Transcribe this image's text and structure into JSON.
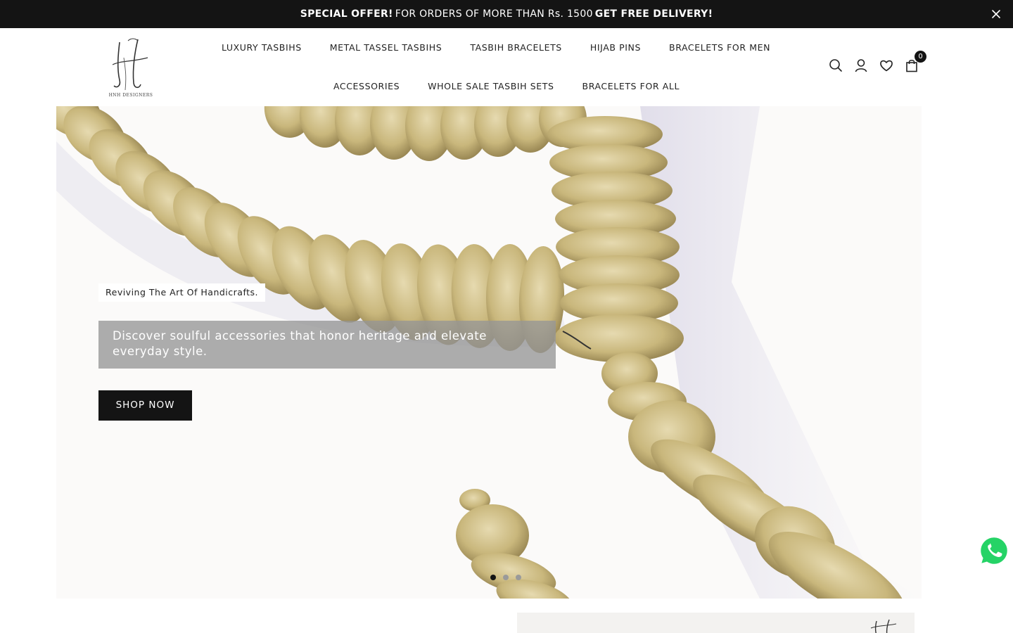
{
  "announcement": {
    "highlight_1": "SPECIAL OFFER!",
    "middle_text": "FOR ORDERS OF MORE THAN Rs. 1500",
    "highlight_2": "GET FREE DELIVERY!",
    "close_icon": "close-icon"
  },
  "brand": {
    "logo_caption": "HNH DESIGNERS"
  },
  "nav": {
    "row1": [
      {
        "label": "LUXURY TASBIHS"
      },
      {
        "label": "METAL TASSEL TASBIHS"
      },
      {
        "label": "TASBIH BRACELETS"
      },
      {
        "label": "HIJAB PINS"
      },
      {
        "label": "BRACELETS FOR MEN"
      }
    ],
    "row2": [
      {
        "label": "ACCESSORIES"
      },
      {
        "label": "WHOLE SALE TASBIH SETS"
      },
      {
        "label": "BRACELETS FOR ALL"
      }
    ]
  },
  "header_icons": {
    "search": "search-icon",
    "account": "user-icon",
    "wishlist": "heart-icon",
    "cart": "bag-icon",
    "cart_count": "0"
  },
  "hero": {
    "tagline": "Reviving The Art Of Handicrafts.",
    "description": "Discover soulful accessories that honor heritage and elevate everyday style.",
    "cta_label": "SHOP NOW",
    "slide_count": 3,
    "active_slide": 1
  },
  "floating": {
    "whatsapp": "whatsapp-icon"
  },
  "colors": {
    "dark": "#141414",
    "bead": "#c8b87e",
    "overlay": "#969696"
  }
}
